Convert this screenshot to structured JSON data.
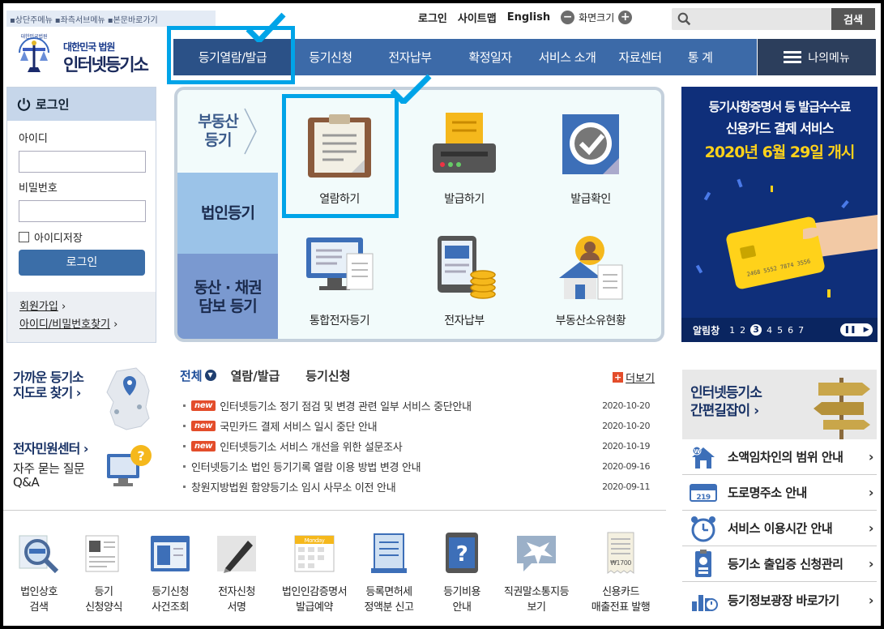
{
  "skip_links": [
    "상단주메뉴",
    "좌측서브메뉴",
    "본문바로가기"
  ],
  "util": {
    "login": "로그인",
    "sitemap": "사이트맵",
    "english": "English",
    "zoom_label": "화면크기",
    "zoom_out": "−",
    "zoom_in": "+"
  },
  "search": {
    "placeholder": "",
    "button": "검색"
  },
  "logo": {
    "line1": "대한민국 법원",
    "line2": "인터넷등기소",
    "seal_text": "대한민국법원"
  },
  "gnb": [
    "등기열람/발급",
    "등기신청",
    "전자납부",
    "확정일자",
    "서비스 소개",
    "자료센터",
    "통 계"
  ],
  "my_menu": "나의메뉴",
  "login": {
    "title": "로그인",
    "id_label": "아이디",
    "pw_label": "비밀번호",
    "save_id": "아이디저장",
    "button": "로그인",
    "join": "회원가입",
    "find": "아이디/비밀번호찾기"
  },
  "panel": {
    "tabs": [
      "부동산\n등기",
      "법인등기",
      "동산 · 채권\n담보 등기"
    ],
    "services": [
      "열람하기",
      "발급하기",
      "발급확인",
      "통합전자등기",
      "전자납부",
      "부동산소유현황"
    ]
  },
  "banner": {
    "line1": "등기사항증명서 등 발급수수료",
    "line2": "신용카드 결제 서비스",
    "line3": "2020년 6월 29일 개시",
    "card_number": "2468  5552  7874  3556",
    "bar_label": "알림창",
    "pages": [
      "1",
      "2",
      "3",
      "4",
      "5",
      "6",
      "7"
    ],
    "current_page": "3"
  },
  "left_links": {
    "map_title": "가까운 등기소\n지도로 찾기 ›",
    "center_title": "전자민원센터 ›",
    "faq": "자주 묻는 질문\nQ&A"
  },
  "notice": {
    "tabs": [
      "전체",
      "열람/발급",
      "등기신청"
    ],
    "more": "더보기",
    "new_badge": "new",
    "items": [
      {
        "title": "인터넷등기소 정기 점검 및 변경 관련 일부 서비스 중단안내",
        "date": "2020-10-20",
        "new": true
      },
      {
        "title": "국민카드 결제 서비스 일시 중단 안내",
        "date": "2020-10-20",
        "new": true
      },
      {
        "title": "인터넷등기소 서비스 개선을 위한 설문조사",
        "date": "2020-10-19",
        "new": true
      },
      {
        "title": "인터넷등기소 법인 등기기록 열람 이용 방법 변경 안내",
        "date": "2020-09-16",
        "new": false
      },
      {
        "title": "창원지방법원 함양등기소 임시 사무소 이전 안내",
        "date": "2020-09-11",
        "new": false
      }
    ]
  },
  "bottom_icons": [
    "법인상호\n검색",
    "등기\n신청양식",
    "등기신청\n사건조회",
    "전자신청\n서명",
    "법인인감증명서\n발급예약",
    "등록면허세\n정액분 신고",
    "등기비용\n안내",
    "직권말소통지등\n보기",
    "신용카드\n매출전표 발행"
  ],
  "bottom_icon_texts": {
    "calendar": "Monday",
    "receipt": "₩1700"
  },
  "quick": {
    "title": "인터넷등기소\n간편길잡이 ›",
    "rows": [
      "소액임차인의 범위 안내",
      "도로명주소 안내",
      "서비스 이용시간 안내",
      "등기소 출입증 신청관리",
      "등기정보광장 바로가기"
    ],
    "road_sign": "219"
  },
  "colors": {
    "nav": "#3c6aa8",
    "nav_active": "#2b5187",
    "highlight": "#00a4e8",
    "banner": "#0f2f7a",
    "new_badge": "#e34d2b"
  }
}
